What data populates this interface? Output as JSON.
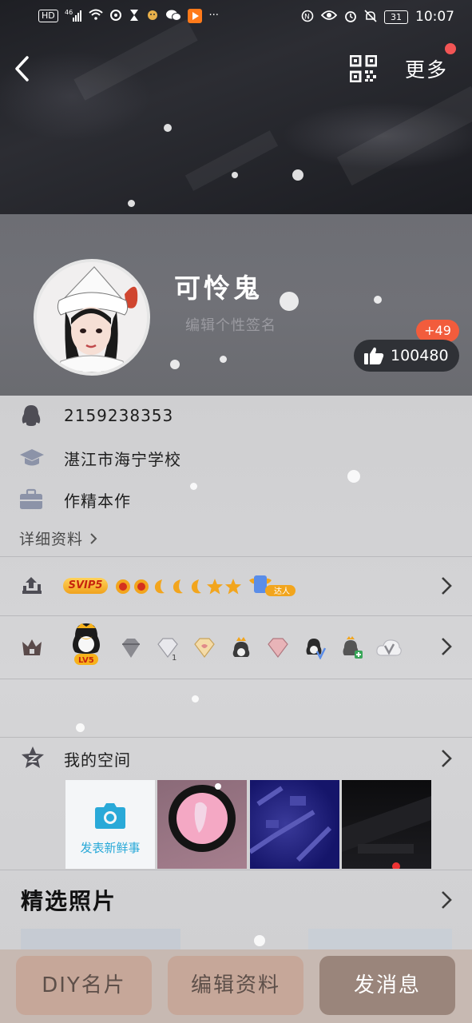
{
  "status_bar": {
    "left_icons": [
      "hd-icon",
      "signal-icon",
      "wifi-icon",
      "sync-icon",
      "hourglass-icon",
      "app-icon",
      "wechat-icon",
      "video-app-icon",
      "more-dots-icon"
    ],
    "hd": "HD",
    "network": "46",
    "dots": "···",
    "battery": "31",
    "time": "10:07"
  },
  "nav": {
    "more_label": "更多"
  },
  "profile": {
    "nickname": "可怜鬼",
    "signature_placeholder": "编辑个性签名",
    "like_increment": "+49",
    "like_count": "100480"
  },
  "info": {
    "qq_number": "2159238353",
    "school": "湛江市海宁学校",
    "job": "作精本作",
    "details_label": "详细资料"
  },
  "levels": {
    "vip_label": "SVIP5",
    "daren_label": "达人",
    "icons": [
      "sun-icon",
      "sun-icon",
      "moon-icon",
      "moon-icon",
      "moon-icon",
      "star-icon",
      "star-icon"
    ]
  },
  "badges": {
    "lv_label": "LV5",
    "diamond_count": "1"
  },
  "space": {
    "title": "我的空间",
    "post_label": "发表新鲜事"
  },
  "featured": {
    "title": "精选照片"
  },
  "bottom": {
    "diy_label": "DIY名片",
    "edit_label": "编辑资料",
    "message_label": "发消息"
  },
  "colors": {
    "accent_red": "#f25c3c",
    "vip_gold": "#f0a21d",
    "post_blue": "#29a9d8",
    "button_tan": "#c6a799",
    "button_dark": "#9a857b"
  }
}
